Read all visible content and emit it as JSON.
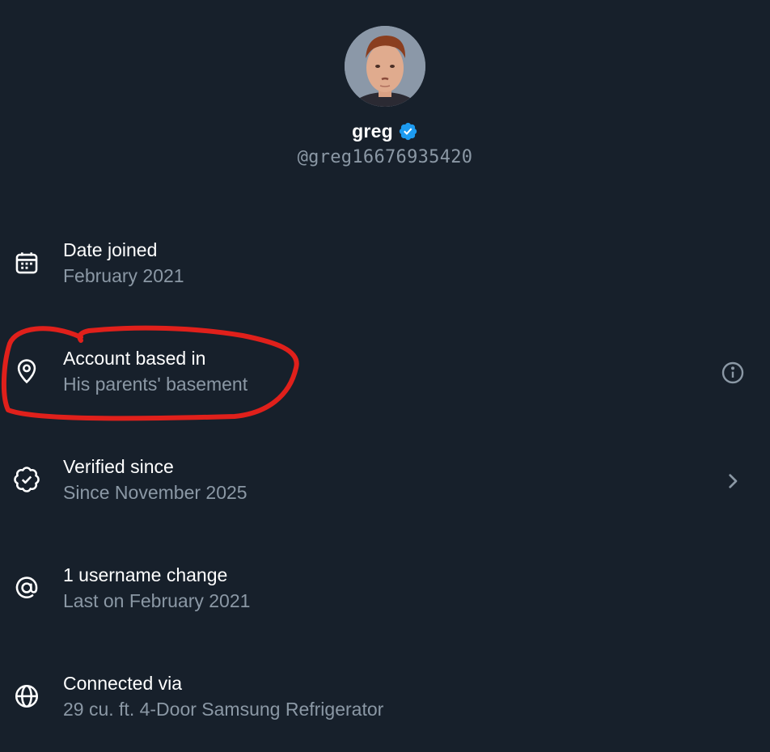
{
  "profile": {
    "display_name": "greg",
    "handle": "@greg16676935420",
    "verified": true,
    "verified_color": "#1d9bf0"
  },
  "info_rows": [
    {
      "icon": "calendar-icon",
      "title": "Date joined",
      "subtitle": "February 2021"
    },
    {
      "icon": "location-pin-icon",
      "title": "Account based in",
      "subtitle": "His parents' basement",
      "action_icon": "info-icon"
    },
    {
      "icon": "verified-badge-outline-icon",
      "title": "Verified since",
      "subtitle": "Since November 2025",
      "action_icon": "chevron-right-icon"
    },
    {
      "icon": "at-sign-icon",
      "title": "1 username change",
      "subtitle": "Last on February 2021"
    },
    {
      "icon": "globe-icon",
      "title": "Connected via",
      "subtitle": "29 cu. ft. 4-Door Samsung Refrigerator"
    }
  ],
  "colors": {
    "background": "#17202b",
    "primary_text": "#ffffff",
    "secondary_text": "#8b98a5",
    "annotation": "#e0201b"
  }
}
